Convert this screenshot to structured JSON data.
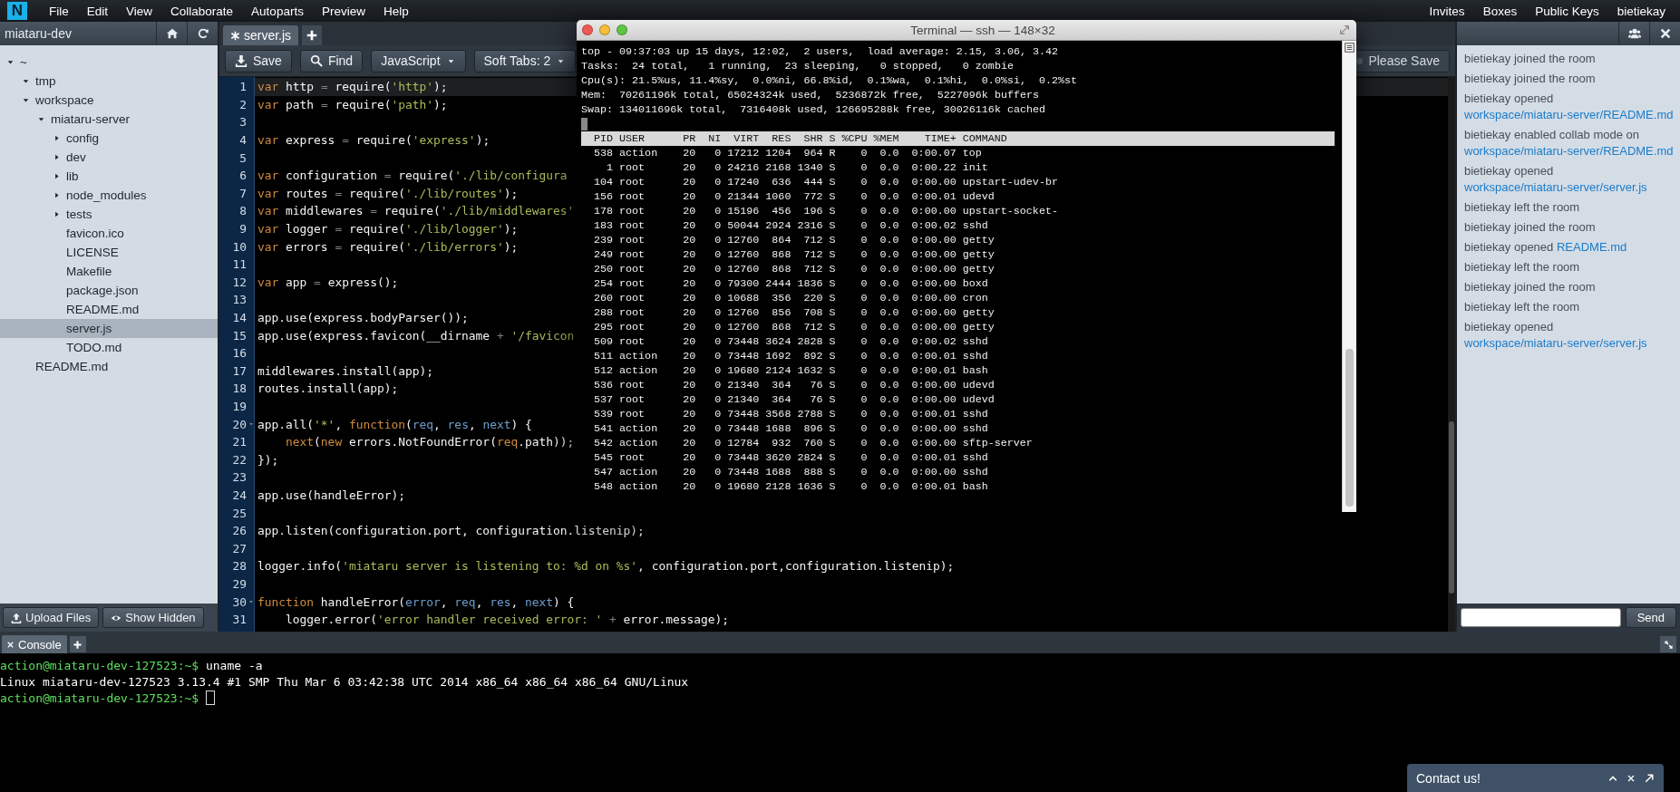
{
  "menubar": {
    "logo": "N",
    "items": [
      "File",
      "Edit",
      "View",
      "Collaborate",
      "Autoparts",
      "Preview",
      "Help"
    ],
    "right_items": [
      "Invites",
      "Boxes",
      "Public Keys",
      "bietiekay"
    ]
  },
  "sidebar": {
    "title": "miataru-dev",
    "tree": [
      {
        "label": "~",
        "kind": "folder",
        "expanded": true,
        "selected": false,
        "children": [
          {
            "label": "tmp",
            "kind": "folder",
            "expanded": true,
            "selected": false
          },
          {
            "label": "workspace",
            "kind": "folder",
            "expanded": true,
            "selected": false,
            "children": [
              {
                "label": "miataru-server",
                "kind": "folder",
                "expanded": true,
                "selected": false,
                "children": [
                  {
                    "label": "config",
                    "kind": "folder",
                    "expanded": false,
                    "selected": false
                  },
                  {
                    "label": "dev",
                    "kind": "folder",
                    "expanded": false,
                    "selected": false
                  },
                  {
                    "label": "lib",
                    "kind": "folder",
                    "expanded": false,
                    "selected": false
                  },
                  {
                    "label": "node_modules",
                    "kind": "folder",
                    "expanded": false,
                    "selected": false
                  },
                  {
                    "label": "tests",
                    "kind": "folder",
                    "expanded": false,
                    "selected": false
                  },
                  {
                    "label": "favicon.ico",
                    "kind": "file",
                    "selected": false
                  },
                  {
                    "label": "LICENSE",
                    "kind": "file",
                    "selected": false
                  },
                  {
                    "label": "Makefile",
                    "kind": "file",
                    "selected": false
                  },
                  {
                    "label": "package.json",
                    "kind": "file",
                    "selected": false
                  },
                  {
                    "label": "README.md",
                    "kind": "file",
                    "selected": false
                  },
                  {
                    "label": "server.js",
                    "kind": "file",
                    "selected": true
                  },
                  {
                    "label": "TODO.md",
                    "kind": "file",
                    "selected": false
                  }
                ]
              }
            ]
          },
          {
            "label": "README.md",
            "kind": "file",
            "selected": false
          }
        ]
      }
    ],
    "buttons": [
      {
        "kind": "upload",
        "label": "Upload Files"
      },
      {
        "kind": "show",
        "label": "Show Hidden"
      }
    ]
  },
  "editor": {
    "tabs": [
      {
        "label": "server.js",
        "modified": true,
        "selected": true
      }
    ],
    "toolbar": [
      {
        "kind": "save",
        "label": "Save"
      },
      {
        "kind": "find",
        "label": "Find"
      },
      {
        "kind": "dropdown",
        "label": "JavaScript"
      },
      {
        "kind": "dropdown",
        "label": "Soft Tabs: 2"
      }
    ],
    "save_status": "Please Save",
    "lines": [
      {
        "number": "1",
        "current": true,
        "foldable": false,
        "tokens": [
          {
            "kind": "keyword",
            "text": "var"
          },
          {
            "kind": "ident",
            "text": " http "
          },
          {
            "kind": "op",
            "text": "="
          },
          {
            "kind": "ident",
            "text": " require("
          },
          {
            "kind": "string",
            "text": "'http'"
          },
          {
            "kind": "ident",
            "text": ");"
          }
        ]
      },
      {
        "number": "2",
        "current": false,
        "foldable": false,
        "tokens": [
          {
            "kind": "keyword",
            "text": "var"
          },
          {
            "kind": "ident",
            "text": " path "
          },
          {
            "kind": "op",
            "text": "="
          },
          {
            "kind": "ident",
            "text": " require("
          },
          {
            "kind": "string",
            "text": "'path'"
          },
          {
            "kind": "ident",
            "text": ");"
          }
        ]
      },
      {
        "number": "3",
        "current": false,
        "foldable": false
      },
      {
        "number": "4",
        "current": false,
        "foldable": false,
        "tokens": [
          {
            "kind": "keyword",
            "text": "var"
          },
          {
            "kind": "ident",
            "text": " express "
          },
          {
            "kind": "op",
            "text": "="
          },
          {
            "kind": "ident",
            "text": " require("
          },
          {
            "kind": "string",
            "text": "'express'"
          },
          {
            "kind": "ident",
            "text": ");"
          }
        ]
      },
      {
        "number": "5",
        "current": false,
        "foldable": false
      },
      {
        "number": "6",
        "current": false,
        "foldable": false,
        "tokens": [
          {
            "kind": "keyword",
            "text": "var"
          },
          {
            "kind": "ident",
            "text": " configuration "
          },
          {
            "kind": "op",
            "text": "="
          },
          {
            "kind": "ident",
            "text": " require("
          },
          {
            "kind": "string",
            "text": "'./lib/configura"
          }
        ]
      },
      {
        "number": "7",
        "current": false,
        "foldable": false,
        "tokens": [
          {
            "kind": "keyword",
            "text": "var"
          },
          {
            "kind": "ident",
            "text": " routes "
          },
          {
            "kind": "op",
            "text": "="
          },
          {
            "kind": "ident",
            "text": " require("
          },
          {
            "kind": "string",
            "text": "'./lib/routes'"
          },
          {
            "kind": "ident",
            "text": ");"
          }
        ]
      },
      {
        "number": "8",
        "current": false,
        "foldable": false,
        "tokens": [
          {
            "kind": "keyword",
            "text": "var"
          },
          {
            "kind": "ident",
            "text": " middlewares "
          },
          {
            "kind": "op",
            "text": "="
          },
          {
            "kind": "ident",
            "text": " require("
          },
          {
            "kind": "string",
            "text": "'./lib/middlewares'"
          }
        ]
      },
      {
        "number": "9",
        "current": false,
        "foldable": false,
        "tokens": [
          {
            "kind": "keyword",
            "text": "var"
          },
          {
            "kind": "ident",
            "text": " logger "
          },
          {
            "kind": "op",
            "text": "="
          },
          {
            "kind": "ident",
            "text": " require("
          },
          {
            "kind": "string",
            "text": "'./lib/logger'"
          },
          {
            "kind": "ident",
            "text": ");"
          }
        ]
      },
      {
        "number": "10",
        "current": false,
        "foldable": false,
        "tokens": [
          {
            "kind": "keyword",
            "text": "var"
          },
          {
            "kind": "ident",
            "text": " errors "
          },
          {
            "kind": "op",
            "text": "="
          },
          {
            "kind": "ident",
            "text": " require("
          },
          {
            "kind": "string",
            "text": "'./lib/errors'"
          },
          {
            "kind": "ident",
            "text": ");"
          }
        ]
      },
      {
        "number": "11",
        "current": false,
        "foldable": false
      },
      {
        "number": "12",
        "current": false,
        "foldable": false,
        "tokens": [
          {
            "kind": "keyword",
            "text": "var"
          },
          {
            "kind": "ident",
            "text": " app "
          },
          {
            "kind": "op",
            "text": "="
          },
          {
            "kind": "ident",
            "text": " express();"
          }
        ]
      },
      {
        "number": "13",
        "current": false,
        "foldable": false
      },
      {
        "number": "14",
        "current": false,
        "foldable": false,
        "tokens": [
          {
            "kind": "ident",
            "text": "app.use(express.bodyParser());"
          }
        ]
      },
      {
        "number": "15",
        "current": false,
        "foldable": false,
        "tokens": [
          {
            "kind": "ident",
            "text": "app.use(express.favicon(__dirname "
          },
          {
            "kind": "op",
            "text": "+ "
          },
          {
            "kind": "string",
            "text": "'/favicon"
          }
        ]
      },
      {
        "number": "16",
        "current": false,
        "foldable": false
      },
      {
        "number": "17",
        "current": false,
        "foldable": false,
        "tokens": [
          {
            "kind": "ident",
            "text": "middlewares.install(app);"
          }
        ]
      },
      {
        "number": "18",
        "current": false,
        "foldable": false,
        "tokens": [
          {
            "kind": "ident",
            "text": "routes.install(app);"
          }
        ]
      },
      {
        "number": "19",
        "current": false,
        "foldable": false
      },
      {
        "number": "20",
        "current": false,
        "foldable": true,
        "tokens": [
          {
            "kind": "ident",
            "text": "app.all("
          },
          {
            "kind": "string",
            "text": "'*'"
          },
          {
            "kind": "ident",
            "text": ", "
          },
          {
            "kind": "keyword",
            "text": "function"
          },
          {
            "kind": "ident",
            "text": "("
          },
          {
            "kind": "param",
            "text": "req"
          },
          {
            "kind": "ident",
            "text": ", "
          },
          {
            "kind": "param",
            "text": "res"
          },
          {
            "kind": "ident",
            "text": ", "
          },
          {
            "kind": "param",
            "text": "next"
          },
          {
            "kind": "ident",
            "text": ") {"
          }
        ]
      },
      {
        "number": "21",
        "current": false,
        "foldable": false,
        "tokens": [
          {
            "kind": "local",
            "text": "    next"
          },
          {
            "kind": "ident",
            "text": "("
          },
          {
            "kind": "keyword",
            "text": "new"
          },
          {
            "kind": "ident",
            "text": " errors.NotFoundError("
          },
          {
            "kind": "local",
            "text": "req"
          },
          {
            "kind": "ident",
            "text": ".path));"
          }
        ]
      },
      {
        "number": "22",
        "current": false,
        "foldable": false,
        "tokens": [
          {
            "kind": "ident",
            "text": "});"
          }
        ]
      },
      {
        "number": "23",
        "current": false,
        "foldable": false
      },
      {
        "number": "24",
        "current": false,
        "foldable": false,
        "tokens": [
          {
            "kind": "ident",
            "text": "app.use(handleError);"
          }
        ]
      },
      {
        "number": "25",
        "current": false,
        "foldable": false
      },
      {
        "number": "26",
        "current": false,
        "foldable": false,
        "tokens": [
          {
            "kind": "ident",
            "text": "app.listen(configuration.port, configuration.listenip);"
          }
        ]
      },
      {
        "number": "27",
        "current": false,
        "foldable": false
      },
      {
        "number": "28",
        "current": false,
        "foldable": false,
        "tokens": [
          {
            "kind": "ident",
            "text": "logger.info("
          },
          {
            "kind": "string",
            "text": "'miataru server is listening to: %d on %s'"
          },
          {
            "kind": "ident",
            "text": ", configuration.port,configuration.listenip);"
          }
        ]
      },
      {
        "number": "29",
        "current": false,
        "foldable": false
      },
      {
        "number": "30",
        "current": false,
        "foldable": true,
        "tokens": [
          {
            "kind": "keyword",
            "text": "function"
          },
          {
            "kind": "ident",
            "text": " handleError("
          },
          {
            "kind": "param",
            "text": "error"
          },
          {
            "kind": "ident",
            "text": ", "
          },
          {
            "kind": "param",
            "text": "req"
          },
          {
            "kind": "ident",
            "text": ", "
          },
          {
            "kind": "param",
            "text": "res"
          },
          {
            "kind": "ident",
            "text": ", "
          },
          {
            "kind": "param",
            "text": "next"
          },
          {
            "kind": "ident",
            "text": ") {"
          }
        ]
      },
      {
        "number": "31",
        "current": false,
        "foldable": false,
        "tokens": [
          {
            "kind": "ident",
            "text": "    logger.error("
          },
          {
            "kind": "string",
            "text": "'error handler received error: '"
          },
          {
            "kind": "op",
            "text": " +"
          },
          {
            "kind": "ident",
            "text": " error.message);"
          }
        ]
      }
    ]
  },
  "chat": {
    "messages": [
      {
        "text": "bietiekay joined the room"
      },
      {
        "text": "bietiekay joined the room"
      },
      {
        "text": "bietiekay opened",
        "link": "workspace/miataru-server/README.md"
      },
      {
        "text": "bietiekay enabled collab mode on",
        "link": "workspace/miataru-server/README.md"
      },
      {
        "text": "bietiekay opened",
        "link": "workspace/miataru-server/server.js"
      },
      {
        "text": "bietiekay left the room"
      },
      {
        "text": "bietiekay joined the room"
      },
      {
        "text": "bietiekay opened",
        "link": "README.md"
      },
      {
        "text": "bietiekay left the room"
      },
      {
        "text": "bietiekay joined the room"
      },
      {
        "text": "bietiekay left the room"
      },
      {
        "text": "bietiekay opened",
        "link": "workspace/miataru-server/server.js"
      }
    ],
    "send_button": "Send"
  },
  "terminal": {
    "title": "Terminal — ssh — 148×32",
    "summary": [
      "top - 09:37:03 up 15 days, 12:02,  2 users,  load average: 2.15, 3.06, 3.42",
      "Tasks:  24 total,   1 running,  23 sleeping,   0 stopped,   0 zombie",
      "Cpu(s): 21.5%us, 11.4%sy,  0.0%ni, 66.8%id,  0.1%wa,  0.1%hi,  0.0%si,  0.2%st",
      "Mem:  70261196k total, 65024324k used,  5236872k free,  5227096k buffers",
      "Swap: 134011696k total,  7316408k used, 126695288k free, 30026116k cached"
    ],
    "columns": [
      "PID",
      "USER",
      "PR",
      "NI",
      "VIRT",
      "RES",
      "SHR",
      "S",
      "%CPU",
      "%MEM",
      "TIME+",
      "COMMAND"
    ],
    "processes": [
      [
        "538",
        "action",
        "20",
        "0",
        "17212",
        "1204",
        "964",
        "R",
        "0",
        "0.0",
        "0:00.07",
        "top"
      ],
      [
        "1",
        "root",
        "20",
        "0",
        "24216",
        "2168",
        "1340",
        "S",
        "0",
        "0.0",
        "0:00.22",
        "init"
      ],
      [
        "104",
        "root",
        "20",
        "0",
        "17240",
        "636",
        "444",
        "S",
        "0",
        "0.0",
        "0:00.00",
        "upstart-udev-br"
      ],
      [
        "156",
        "root",
        "20",
        "0",
        "21344",
        "1060",
        "772",
        "S",
        "0",
        "0.0",
        "0:00.01",
        "udevd"
      ],
      [
        "178",
        "root",
        "20",
        "0",
        "15196",
        "456",
        "196",
        "S",
        "0",
        "0.0",
        "0:00.00",
        "upstart-socket-"
      ],
      [
        "183",
        "root",
        "20",
        "0",
        "50044",
        "2924",
        "2316",
        "S",
        "0",
        "0.0",
        "0:00.02",
        "sshd"
      ],
      [
        "239",
        "root",
        "20",
        "0",
        "12760",
        "864",
        "712",
        "S",
        "0",
        "0.0",
        "0:00.00",
        "getty"
      ],
      [
        "249",
        "root",
        "20",
        "0",
        "12760",
        "868",
        "712",
        "S",
        "0",
        "0.0",
        "0:00.00",
        "getty"
      ],
      [
        "250",
        "root",
        "20",
        "0",
        "12760",
        "868",
        "712",
        "S",
        "0",
        "0.0",
        "0:00.00",
        "getty"
      ],
      [
        "254",
        "root",
        "20",
        "0",
        "79300",
        "2444",
        "1836",
        "S",
        "0",
        "0.0",
        "0:00.00",
        "boxd"
      ],
      [
        "260",
        "root",
        "20",
        "0",
        "10688",
        "356",
        "220",
        "S",
        "0",
        "0.0",
        "0:00.00",
        "cron"
      ],
      [
        "288",
        "root",
        "20",
        "0",
        "12760",
        "856",
        "708",
        "S",
        "0",
        "0.0",
        "0:00.00",
        "getty"
      ],
      [
        "295",
        "root",
        "20",
        "0",
        "12760",
        "868",
        "712",
        "S",
        "0",
        "0.0",
        "0:00.00",
        "getty"
      ],
      [
        "509",
        "root",
        "20",
        "0",
        "73448",
        "3624",
        "2828",
        "S",
        "0",
        "0.0",
        "0:00.02",
        "sshd"
      ],
      [
        "511",
        "action",
        "20",
        "0",
        "73448",
        "1692",
        "892",
        "S",
        "0",
        "0.0",
        "0:00.01",
        "sshd"
      ],
      [
        "512",
        "action",
        "20",
        "0",
        "19680",
        "2124",
        "1632",
        "S",
        "0",
        "0.0",
        "0:00.01",
        "bash"
      ],
      [
        "536",
        "root",
        "20",
        "0",
        "21340",
        "364",
        "76",
        "S",
        "0",
        "0.0",
        "0:00.00",
        "udevd"
      ],
      [
        "537",
        "root",
        "20",
        "0",
        "21340",
        "364",
        "76",
        "S",
        "0",
        "0.0",
        "0:00.00",
        "udevd"
      ],
      [
        "539",
        "root",
        "20",
        "0",
        "73448",
        "3568",
        "2788",
        "S",
        "0",
        "0.0",
        "0:00.01",
        "sshd"
      ],
      [
        "541",
        "action",
        "20",
        "0",
        "73448",
        "1688",
        "896",
        "S",
        "0",
        "0.0",
        "0:00.00",
        "sshd"
      ],
      [
        "542",
        "action",
        "20",
        "0",
        "12784",
        "932",
        "760",
        "S",
        "0",
        "0.0",
        "0:00.00",
        "sftp-server"
      ],
      [
        "545",
        "root",
        "20",
        "0",
        "73448",
        "3620",
        "2824",
        "S",
        "0",
        "0.0",
        "0:00.01",
        "sshd"
      ],
      [
        "547",
        "action",
        "20",
        "0",
        "73448",
        "1688",
        "888",
        "S",
        "0",
        "0.0",
        "0:00.00",
        "sshd"
      ],
      [
        "548",
        "action",
        "20",
        "0",
        "19680",
        "2128",
        "1636",
        "S",
        "0",
        "0.0",
        "0:00.01",
        "bash"
      ]
    ]
  },
  "console": {
    "tabs": [
      {
        "label": "Console",
        "selected": true
      }
    ],
    "lines": [
      {
        "kind": "prompt",
        "prompt": "action@miataru-dev-127523:~$",
        "command": "uname -a",
        "cursor": false
      },
      {
        "kind": "output",
        "text": "Linux miataru-dev-127523 3.13.4 #1 SMP Thu Mar 6 03:42:38 UTC 2014 x86_64 x86_64 x86_64 GNU/Linux"
      },
      {
        "kind": "prompt",
        "prompt": "action@miataru-dev-127523:~$",
        "cursor": true
      }
    ]
  },
  "contact": {
    "label": "Contact us!"
  }
}
